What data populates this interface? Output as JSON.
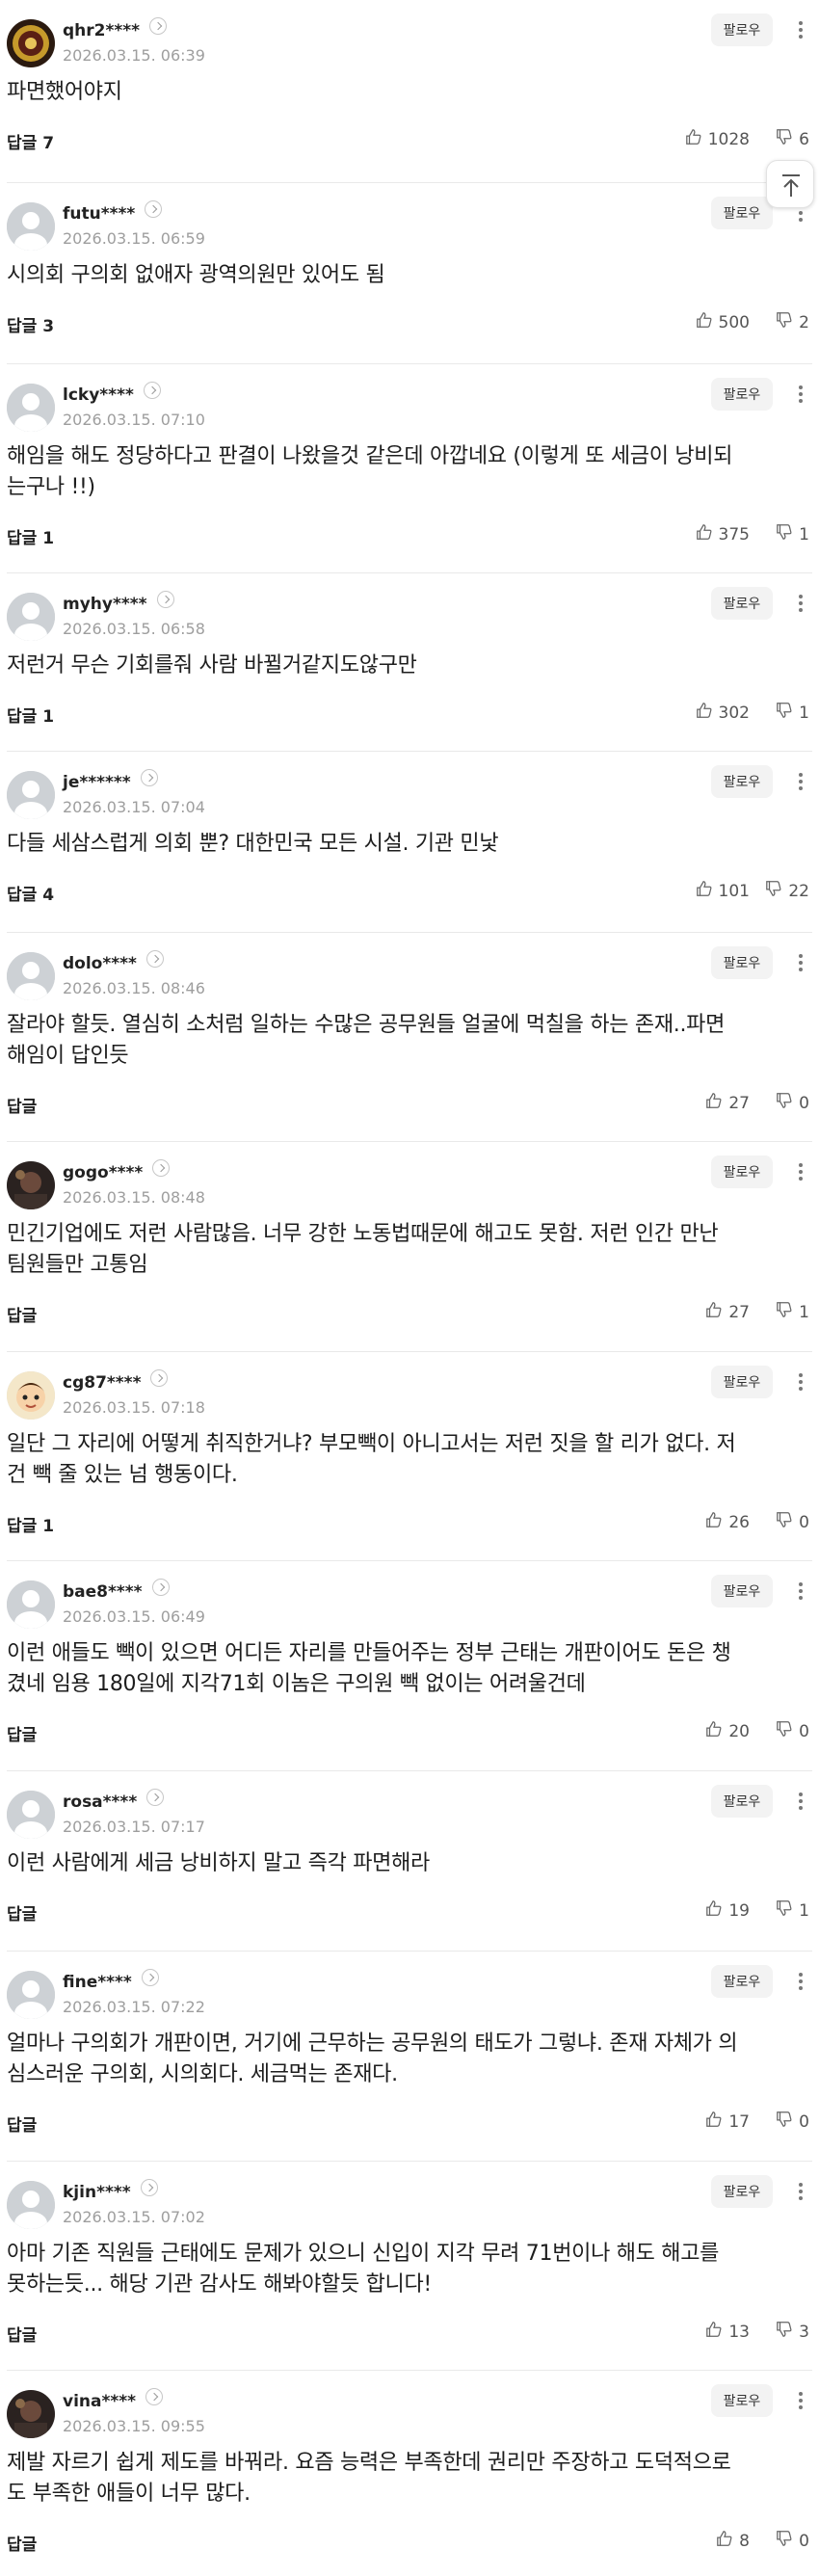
{
  "comments": [
    {
      "user": "qhr2****",
      "date": "2026.03.15. 06:39",
      "text": [
        "파면했어야지"
      ],
      "reply": "답글 7",
      "likes": "1028",
      "dislikes": "6",
      "avatar": "gold-emblem"
    },
    {
      "user": "futu****",
      "date": "2026.03.15. 06:59",
      "text": [
        "시의회 구의회 없애자 광역의원만 있어도 됨"
      ],
      "reply": "답글 3",
      "likes": "500",
      "dislikes": "2",
      "avatar": "default"
    },
    {
      "user": "lcky****",
      "date": "2026.03.15. 07:10",
      "text": [
        "해임을 해도 정당하다고 판결이 나왔을것 같은데 아깝네요 (이렇게 또 세금이 낭비되",
        "는구나 !!)"
      ],
      "reply": "답글 1",
      "likes": "375",
      "dislikes": "1",
      "avatar": "default"
    },
    {
      "user": "myhy****",
      "date": "2026.03.15. 06:58",
      "text": [
        "저런거 무슨 기회를줘 사람 바뀔거같지도않구만"
      ],
      "reply": "답글 1",
      "likes": "302",
      "dislikes": "1",
      "avatar": "default"
    },
    {
      "user": "je******",
      "date": "2026.03.15. 07:04",
      "text": [
        "다들 세삼스럽게 의회 뿐? 대한민국 모든 시설. 기관 민낯"
      ],
      "reply": "답글 4",
      "likes": "101",
      "dislikes": "22",
      "avatar": "default"
    },
    {
      "user": "dolo****",
      "date": "2026.03.15. 08:46",
      "text": [
        "잘라야 할듯. 열심히 소처럼 일하는 수많은 공무원들 얼굴에 먹칠을 하는 존재..파면",
        "해임이 답인듯"
      ],
      "reply": "답글",
      "likes": "27",
      "dislikes": "0",
      "avatar": "default"
    },
    {
      "user": "gogo****",
      "date": "2026.03.15. 08:48",
      "text": [
        "민긴기업에도 저런 사람많음. 너무 강한 노동법때문에 해고도 못함. 저런 인간 만난",
        "팀원들만 고통임"
      ],
      "reply": "답글",
      "likes": "27",
      "dislikes": "1",
      "avatar": "dark-photo"
    },
    {
      "user": "cg87****",
      "date": "2026.03.15. 07:18",
      "text": [
        "일단 그 자리에 어떻게 취직한거냐? 부모빽이 아니고서는 저런 짓을 할 리가 없다. 저",
        "건 빽 줄 있는 넘 행동이다."
      ],
      "reply": "답글 1",
      "likes": "26",
      "dislikes": "0",
      "avatar": "cartoon-boy"
    },
    {
      "user": "bae8****",
      "date": "2026.03.15. 06:49",
      "text": [
        "이런 애들도 빽이 있으면 어디든 자리를 만들어주는 정부 근태는 개판이어도 돈은 챙",
        "겼네 임용 180일에 지각71회 이놈은 구의원 빽 없이는 어려울건데"
      ],
      "reply": "답글",
      "likes": "20",
      "dislikes": "0",
      "avatar": "default"
    },
    {
      "user": "rosa****",
      "date": "2026.03.15. 07:17",
      "text": [
        "이런 사람에게 세금 낭비하지 말고 즉각 파면해라"
      ],
      "reply": "답글",
      "likes": "19",
      "dislikes": "1",
      "avatar": "default"
    },
    {
      "user": "fine****",
      "date": "2026.03.15. 07:22",
      "text": [
        "얼마나 구의회가 개판이면, 거기에 근무하는 공무원의 태도가 그렇냐. 존재 자체가 의",
        "심스러운 구의회, 시의회다. 세금먹는 존재다."
      ],
      "reply": "답글",
      "likes": "17",
      "dislikes": "0",
      "avatar": "default"
    },
    {
      "user": "kjin****",
      "date": "2026.03.15. 07:02",
      "text": [
        "아마 기존 직원들 근태에도 문제가 있으니 신입이 지각 무려 71번이나 해도 해고를",
        "못하는듯... 해당 기관 감사도 해봐야할듯 합니다!"
      ],
      "reply": "답글",
      "likes": "13",
      "dislikes": "3",
      "avatar": "default"
    },
    {
      "user": "vina****",
      "date": "2026.03.15. 09:55",
      "text": [
        "제발 자르기 쉽게 제도를 바꿔라. 요즘 능력은 부족한데 권리만 주장하고 도덕적으로",
        "도 부족한 애들이 너무 많다."
      ],
      "reply": "답글",
      "likes": "8",
      "dislikes": "0",
      "avatar": "dark-photo"
    }
  ],
  "follow_label": "팔로우",
  "icons": {
    "more": "kebab-icon",
    "like": "thumbs-up-icon",
    "dislike": "thumbs-down-icon",
    "top": "scroll-top-icon"
  }
}
